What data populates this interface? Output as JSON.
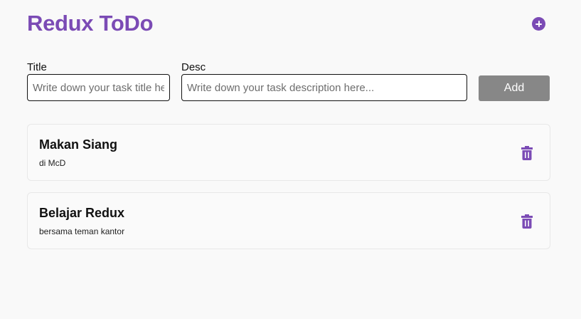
{
  "header": {
    "title": "Redux ToDo",
    "add_icon": "plus-circle-icon"
  },
  "form": {
    "title_label": "Title",
    "title_placeholder": "Write down your task title here...",
    "title_value": "",
    "desc_label": "Desc",
    "desc_placeholder": "Write down your task description here...",
    "desc_value": "",
    "add_label": "Add"
  },
  "todos": [
    {
      "title": "Makan Siang",
      "desc": "di McD",
      "delete_icon": "trash-icon"
    },
    {
      "title": "Belajar Redux",
      "desc": "bersama teman kantor",
      "delete_icon": "trash-icon"
    }
  ],
  "colors": {
    "brand": "#7b4bb5",
    "button": "#878787",
    "background": "#f9f9f9"
  }
}
